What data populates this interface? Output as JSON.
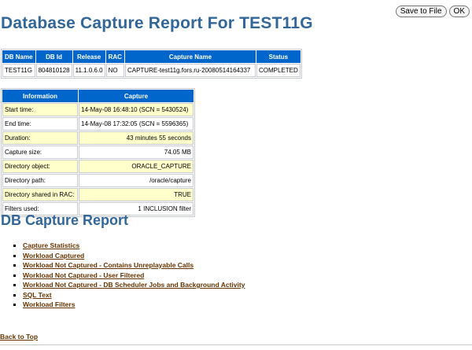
{
  "toolbar": {
    "save_label": "Save to File",
    "ok_label": "OK"
  },
  "page_title": "Database Capture Report For TEST11G",
  "db_table": {
    "headers": [
      "DB Name",
      "DB Id",
      "Release",
      "RAC",
      "Capture Name",
      "Status"
    ],
    "row": [
      "TEST11G",
      "804810128",
      "11.1.0.6.0",
      "NO",
      "CAPTURE-test11g.fors.ru-20080514164337",
      "COMPLETED"
    ]
  },
  "info_table": {
    "headers": [
      "Information",
      "Capture"
    ],
    "rows": [
      [
        "Start time:",
        "14-May-08 16:48:10 (SCN = 5430524)"
      ],
      [
        "End time:",
        "14-May-08 17:32:05 (SCN = 5596365)"
      ],
      [
        "Duration:",
        "43 minutes 55 seconds"
      ],
      [
        "Capture size:",
        "74.05 MB"
      ],
      [
        "Directory object:",
        "ORACLE_CAPTURE"
      ],
      [
        "Directory path:",
        "/oracle/capture"
      ],
      [
        "Directory shared in RAC:",
        "TRUE"
      ],
      [
        "Filters used:",
        "1 INCLUSION filter"
      ]
    ]
  },
  "section_title": "DB Capture Report",
  "links": [
    "Capture Statistics",
    "Workload Captured",
    "Workload Not Captured - Contains Unreplayable Calls",
    "Workload Not Captured - User Filtered",
    "Workload Not Captured - DB Scheduler Jobs and Background Activity",
    "SQL Text",
    "Workload Filters"
  ],
  "back_to_top": "Back to Top"
}
